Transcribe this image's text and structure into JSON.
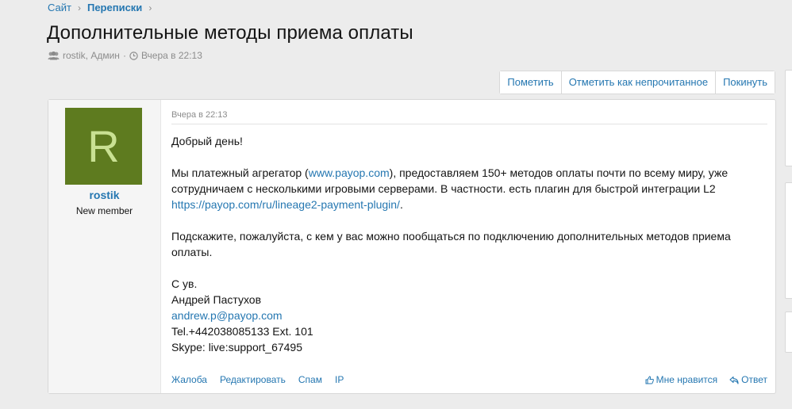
{
  "breadcrumb": {
    "items": [
      "Сайт",
      "Переписки"
    ],
    "separator": "›"
  },
  "thread": {
    "title": "Дополнительные методы приема оплаты",
    "participants": "rostik, Админ",
    "meta_separator": "·",
    "date": "Вчера в 22:13"
  },
  "actions": {
    "bookmark": "Пометить",
    "mark_unread": "Отметить как непрочитанное",
    "leave": "Покинуть"
  },
  "post": {
    "author": {
      "avatar_letter": "R",
      "avatar_color": "#5e7b1f",
      "avatar_letter_color": "#c9e193",
      "username": "rostik",
      "user_title": "New member"
    },
    "date": "Вчера в 22:13",
    "greeting": "Добрый день!",
    "p1_before": "Мы платежный агрегатор (",
    "p1_link": "www.payop.com",
    "p1_after": "), предоставляем 150+ методов оплаты почти по всему миру, уже сотрудничаем с несколькими игровыми серверами. В частности. есть плагин для быстрой интеграции L2 ",
    "p1_link2": "https://payop.com/ru/lineage2-payment-plugin/",
    "p1_end": ".",
    "p2": "Подскажите, пожалуйста, с кем у вас можно пообщаться по подключению дополнительных методов приема оплаты.",
    "signature": {
      "regards": "С ув.",
      "name": "Андрей Пастухов",
      "email": "andrew.p@payop.com",
      "tel": "Tel.+442038085133 Ext. 101",
      "skype": "Skype: live:support_67495"
    },
    "footer": {
      "report": "Жалоба",
      "edit": "Редактировать",
      "spam": "Спам",
      "ip": "IP",
      "like": "Мне нравится",
      "reply": "Ответ"
    }
  },
  "icons": {
    "participants": "users-icon",
    "date": "clock-icon",
    "like": "thumbs-up-icon",
    "reply": "reply-icon"
  },
  "colors": {
    "link": "#2577b1",
    "muted": "#8c8c8c",
    "background": "#ececec"
  }
}
